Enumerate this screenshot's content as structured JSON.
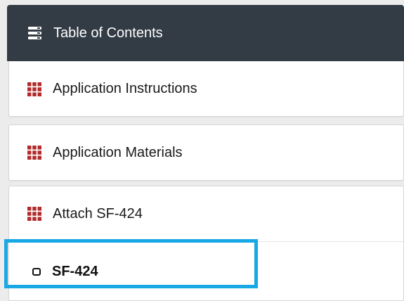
{
  "header": {
    "title": "Table of Contents",
    "icon": "list-icon",
    "background": "#333b45"
  },
  "items": [
    {
      "label": "Application Instructions",
      "icon": "grid-icon"
    },
    {
      "label": "Application Materials",
      "icon": "grid-icon"
    },
    {
      "label": "Attach SF-424",
      "icon": "grid-icon"
    }
  ],
  "subitem": {
    "label": "SF-424",
    "icon": "checkbox-icon",
    "checked": false
  },
  "colors": {
    "grid_icon": "#b22a2a",
    "highlight": "#18a8e6"
  }
}
